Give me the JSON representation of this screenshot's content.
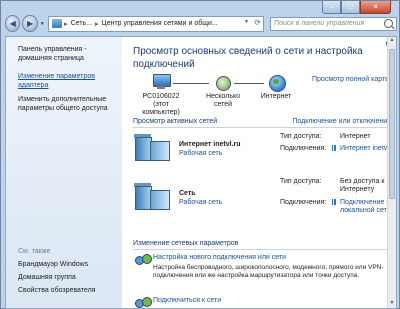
{
  "window": {
    "minimize": "–",
    "maximize": "□",
    "close": "✕"
  },
  "nav": {
    "back": "◀",
    "forward": "▶",
    "drop": "▼",
    "address": [
      "Сеть...",
      "Центр управления сетями и общи..."
    ],
    "address_sep": "▸",
    "search_placeholder": "Поиск в панели управления"
  },
  "sidebar": {
    "home": "Панель управления - домашняя страница",
    "active": "Изменение параметров адаптера",
    "advanced": "Изменить дополнительные параметры общего доступа",
    "see_also": "См. также",
    "links": [
      "Брандмауэр Windows",
      "Домашняя группа",
      "Свойства обозревателя"
    ]
  },
  "main": {
    "title": "Просмотр основных сведений о сети и настройка подключений",
    "map": {
      "pc": "PC0106022",
      "pc_sub": "(этот компьютер)",
      "multi": "Несколько сетей",
      "internet": "Интернет",
      "full_map": "Просмотр полной карты"
    },
    "active_head": "Просмотр активных сетей",
    "connect_link": "Подключение или отключение",
    "access_label": "Тип доступа:",
    "conn_label": "Подключения:",
    "networks": [
      {
        "name": "Интернет inetvl.ru",
        "type": "Рабочая сеть",
        "access": "Интернет",
        "conn": "Интернет inetvl.ru"
      },
      {
        "name": "Сеть",
        "type": "Рабочая сеть",
        "access": "Без доступа к Интернету",
        "conn": "Подключение по локальной сети"
      }
    ],
    "change_head": "Изменение сетевых параметров",
    "tasks": [
      {
        "title": "Настройка нового подключения или сети",
        "desc": "Настройка беспроводного, широкополосного, модемного, прямого или VPN-подключения или же настройка маршрутизатора или точки доступа."
      },
      {
        "title": "Подключиться к сети",
        "desc": ""
      }
    ]
  }
}
